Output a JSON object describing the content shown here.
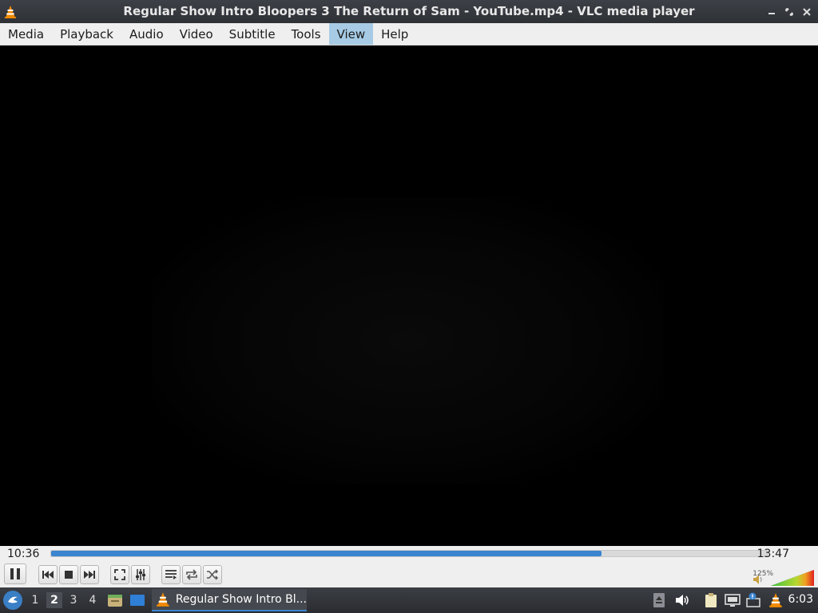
{
  "window": {
    "title": "Regular Show Intro Bloopers 3 The Return of Sam - YouTube.mp4 - VLC media player"
  },
  "menu": {
    "items": [
      {
        "label": "Media"
      },
      {
        "label": "Playback"
      },
      {
        "label": "Audio"
      },
      {
        "label": "Video"
      },
      {
        "label": "Subtitle"
      },
      {
        "label": "Tools"
      },
      {
        "label": "View",
        "active": true
      },
      {
        "label": "Help"
      }
    ]
  },
  "player": {
    "elapsed": "10:36",
    "total": "13:47",
    "progress_fraction": 0.769,
    "volume_label": "125%",
    "volume_fraction": 1.0,
    "accent_color": "#3a84d0"
  },
  "taskbar": {
    "workspaces": [
      "1",
      "2",
      "3",
      "4"
    ],
    "active_workspace": "2",
    "task_label": "Regular Show Intro Bl...",
    "clock": "6:03"
  }
}
